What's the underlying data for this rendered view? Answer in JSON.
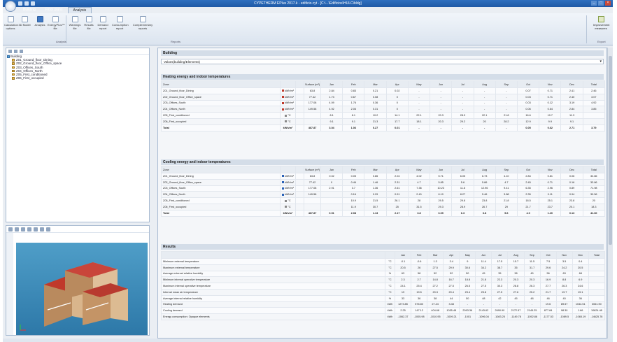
{
  "window": {
    "title": "CYPETHERM EPlus 2017.k - edificio.cyt - [C:\\...\\Edificios\\HULC\\bldg]",
    "controls": [
      "_",
      "□",
      "×"
    ]
  },
  "tabs": [
    {
      "label": "Building"
    },
    {
      "label": "Floor plans"
    },
    {
      "label": "Analysis"
    }
  ],
  "ribbon": {
    "buttons": [
      {
        "label": "Calculation options",
        "icon": "settings-icon"
      },
      {
        "label": "3D Model",
        "icon": "cube-icon"
      },
      {
        "label": "Analysis",
        "icon": "calculator-icon"
      },
      {
        "label": "EnergyPlus™ file",
        "icon": "document-icon"
      },
      {
        "label": "Warnings file",
        "icon": "document-icon"
      },
      {
        "label": "Results file",
        "icon": "document-icon"
      },
      {
        "label": "Demand report",
        "icon": "report-icon"
      },
      {
        "label": "Consumption report",
        "icon": "report-icon"
      },
      {
        "label": "Complementary reports",
        "icon": "report-icon"
      }
    ],
    "groups": [
      "Analysis",
      "Reports",
      "Export"
    ],
    "export_button": {
      "label": "Improvement measures",
      "icon": "improve-icon"
    }
  },
  "tree": {
    "root": "Building",
    "items": [
      "Z01_Ground_floor_Dining",
      "Z02_Ground_floor_Office_space",
      "Z03_Offices_South",
      "Z04_Offices_North",
      "Z05_First_conditioned",
      "Z06_First_occupied"
    ]
  },
  "main": {
    "title": "Building",
    "combo": "Values(building/Elements)",
    "heating": {
      "title": "Heating energy and indoor temperatures",
      "headers": [
        "Zone",
        "",
        "",
        "Surface (m²)",
        "Jan",
        "Feb",
        "Mar",
        "Apr",
        "May",
        "Jun",
        "Jul",
        "Aug",
        "Sep",
        "Oct",
        "Nov",
        "Dec",
        "Total"
      ],
      "rows": [
        [
          "Z01_Ground_floor_Dining",
          "kWh/m²",
          "63.8",
          "2.84",
          "0.83",
          "0.21",
          "0.02",
          "-",
          "-",
          "-",
          "-",
          "-",
          "0.07",
          "0.71",
          "2.41",
          "2.46"
        ],
        [
          "Z02_Ground_floor_Office_space",
          "kWh/m²",
          "77.42",
          "1.73",
          "0.67",
          "0.08",
          "0",
          "-",
          "-",
          "-",
          "-",
          "-",
          "0.03",
          "0.71",
          "2.40",
          "3.07"
        ],
        [
          "Z03_Offices_South",
          "kWh/m²",
          "177.08",
          "4.09",
          "1.76",
          "0.36",
          "0",
          "-",
          "-",
          "-",
          "-",
          "-",
          "0.03",
          "0.12",
          "3.19",
          "4.92"
        ],
        [
          "Z04_Offices_North",
          "kWh/m²",
          "149.58",
          "4.92",
          "2.06",
          "0.31",
          "0",
          "-",
          "-",
          "-",
          "-",
          "-",
          "0.06",
          "0.64",
          "2.84",
          "3.85"
        ],
        [
          "Z05_First_conditioned",
          "°C",
          "",
          "8.1",
          "8.1",
          "10.2",
          "14.1",
          "22.1",
          "20.3",
          "28.3",
          "22.1",
          "21.8",
          "16.6",
          "10.7",
          "11.3",
          ""
        ],
        [
          "Z06_First_occupied",
          "°C",
          "",
          "9.1",
          "9.1",
          "21.3",
          "17.7",
          "18.1",
          "20.3",
          "29.2",
          "20",
          "28.2",
          "12.9",
          "9.9",
          "9.1",
          ""
        ]
      ],
      "total": [
        "Total",
        "kWh/m²",
        "467.87",
        "3.04",
        "1.06",
        "0.27",
        "0.01",
        "-",
        "-",
        "-",
        "-",
        "-",
        "0.05",
        "0.62",
        "2.71",
        "3.79"
      ]
    },
    "cooling": {
      "title": "Cooling energy and indoor temperatures",
      "headers": [
        "Zone",
        "",
        "",
        "Surface (m²)",
        "Jan",
        "Feb",
        "Mar",
        "Apr",
        "May",
        "Jun",
        "Jul",
        "Aug",
        "Sep",
        "Oct",
        "Nov",
        "Dec",
        "Total"
      ],
      "rows": [
        [
          "Z01_Ground_floor_Dining",
          "kWh/m²",
          "63.8",
          "0.02",
          "0.05",
          "0.86",
          "2.04",
          "4.02",
          "5.71",
          "6.05",
          "6.73",
          "4.10",
          "2.84",
          "0.81",
          "0.06",
          "32.86"
        ],
        [
          "Z02_Ground_floor_Office_space",
          "kWh/m²",
          "77.42",
          "0",
          "0.46",
          "1.46",
          "2.31",
          "4.7",
          "5.85",
          "5.6",
          "5.86",
          "4.7",
          "2.45",
          "0.71",
          "0.16",
          "33.86"
        ],
        [
          "Z03_Offices_South",
          "kWh/m²",
          "177.08",
          "2.91",
          "3.7",
          "1.36",
          "2.61",
          "7.38",
          "10.23",
          "11.6",
          "12.96",
          "9.41",
          "6.35",
          "2.96",
          "0.89",
          "71.98"
        ],
        [
          "Z04_Offices_North",
          "kWh/m²",
          "149.58",
          "",
          "0.16",
          "0.29",
          "0.91",
          "2.40",
          "6.10",
          "8.27",
          "5.46",
          "3.88",
          "2.35",
          "0.11",
          "0.94",
          "30.56"
        ],
        [
          "Z05_First_conditioned",
          "°C",
          "",
          "",
          "10.9",
          "21.5",
          "26.1",
          "28",
          "29.5",
          "29.8",
          "23.8",
          "21.8",
          "18.5",
          "25.1",
          "23.8",
          "20"
        ],
        [
          "Z06_First_occupied",
          "°C",
          "",
          "",
          "11.9",
          "30.7",
          "25",
          "31.5",
          "29.3",
          "28.9",
          "26.7",
          "29",
          "21.7",
          "23.7",
          "20.1",
          "18.3"
        ]
      ],
      "total": [
        "Total",
        "kWh/m²",
        "467.87",
        "0.91",
        "2.08",
        "1.13",
        "2.17",
        "3.8",
        "6.09",
        "6.3",
        "6.8",
        "5.6",
        "4.0",
        "1.20",
        "0.13",
        "41.60"
      ]
    },
    "results": {
      "title": "Results",
      "headers": [
        "",
        "",
        "Jan",
        "Feb",
        "Mar",
        "Apr",
        "May",
        "Jun",
        "Jul",
        "Aug",
        "Sep",
        "Oct",
        "Nov",
        "Dec",
        "Total"
      ],
      "rows": [
        [
          "Minimum external temperature",
          "°C",
          "-0.1",
          "-0.6",
          "1.3",
          "3.4",
          "9",
          "11.4",
          "17.5",
          "15.7",
          "11.5",
          "7.5",
          "3.5",
          "0.4",
          ""
        ],
        [
          "Maximum external temperature",
          "°C",
          "20.5",
          "26",
          "27.5",
          "29.9",
          "30.6",
          "34.2",
          "38.7",
          "35",
          "31.7",
          "29.6",
          "24.2",
          "20.5",
          ""
        ],
        [
          "Average external relative humidity",
          "%",
          "63",
          "58",
          "52",
          "52",
          "50",
          "45",
          "35",
          "38",
          "45",
          "56",
          "63",
          "68",
          ""
        ],
        [
          "Minimum internal operative temperature",
          "°C",
          "2.3",
          "2.7",
          "14.8",
          "16.7",
          "18.8",
          "21.8",
          "22.3",
          "20.3",
          "20.3",
          "16.9",
          "8.8",
          "6.9",
          ""
        ],
        [
          "Maximum internal operative temperature",
          "°C",
          "24.1",
          "25.4",
          "27.2",
          "27.5",
          "26.5",
          "27.5",
          "30.3",
          "28.8",
          "26.3",
          "27.7",
          "26.3",
          "24.6",
          ""
        ],
        [
          "Internal mean air temperature",
          "°C",
          "19",
          "19.5",
          "20.3",
          "20.4",
          "23.4",
          "25.8",
          "27.5",
          "27.6",
          "25.2",
          "21.7",
          "19.7",
          "19.1",
          ""
        ],
        [
          "Average internal relative humidity",
          "%",
          "33",
          "36",
          "38",
          "44",
          "50",
          "48",
          "42",
          "45",
          "48",
          "46",
          "40",
          "36",
          ""
        ],
        [
          "Heating demand",
          "kWh",
          "1273.85",
          "576.80",
          "27.44",
          "3.48",
          "-",
          "-",
          "-",
          "-",
          "-",
          "19.6",
          "89.57",
          "1044.51",
          "3061.90"
        ],
        [
          "Cooling demand",
          "kWh",
          "2.25",
          "147.12",
          "404.68",
          "1035.48",
          "2093.36",
          "2143.62",
          "2690.90",
          "2172.57",
          "2145.25",
          "877.84",
          "98.30",
          "1.66",
          "10624.48"
        ],
        [
          "Energy consumption: Opaque elements",
          "kWh",
          "-1062.37",
          "-1005.98",
          "-1010.95",
          "-1009.21",
          "-1001",
          "-1096.04",
          "-1083.25",
          "-1149.78",
          "-1052.86",
          "-1177.53",
          "-1089.5",
          "-1065.19",
          "-14625.76"
        ]
      ]
    }
  }
}
